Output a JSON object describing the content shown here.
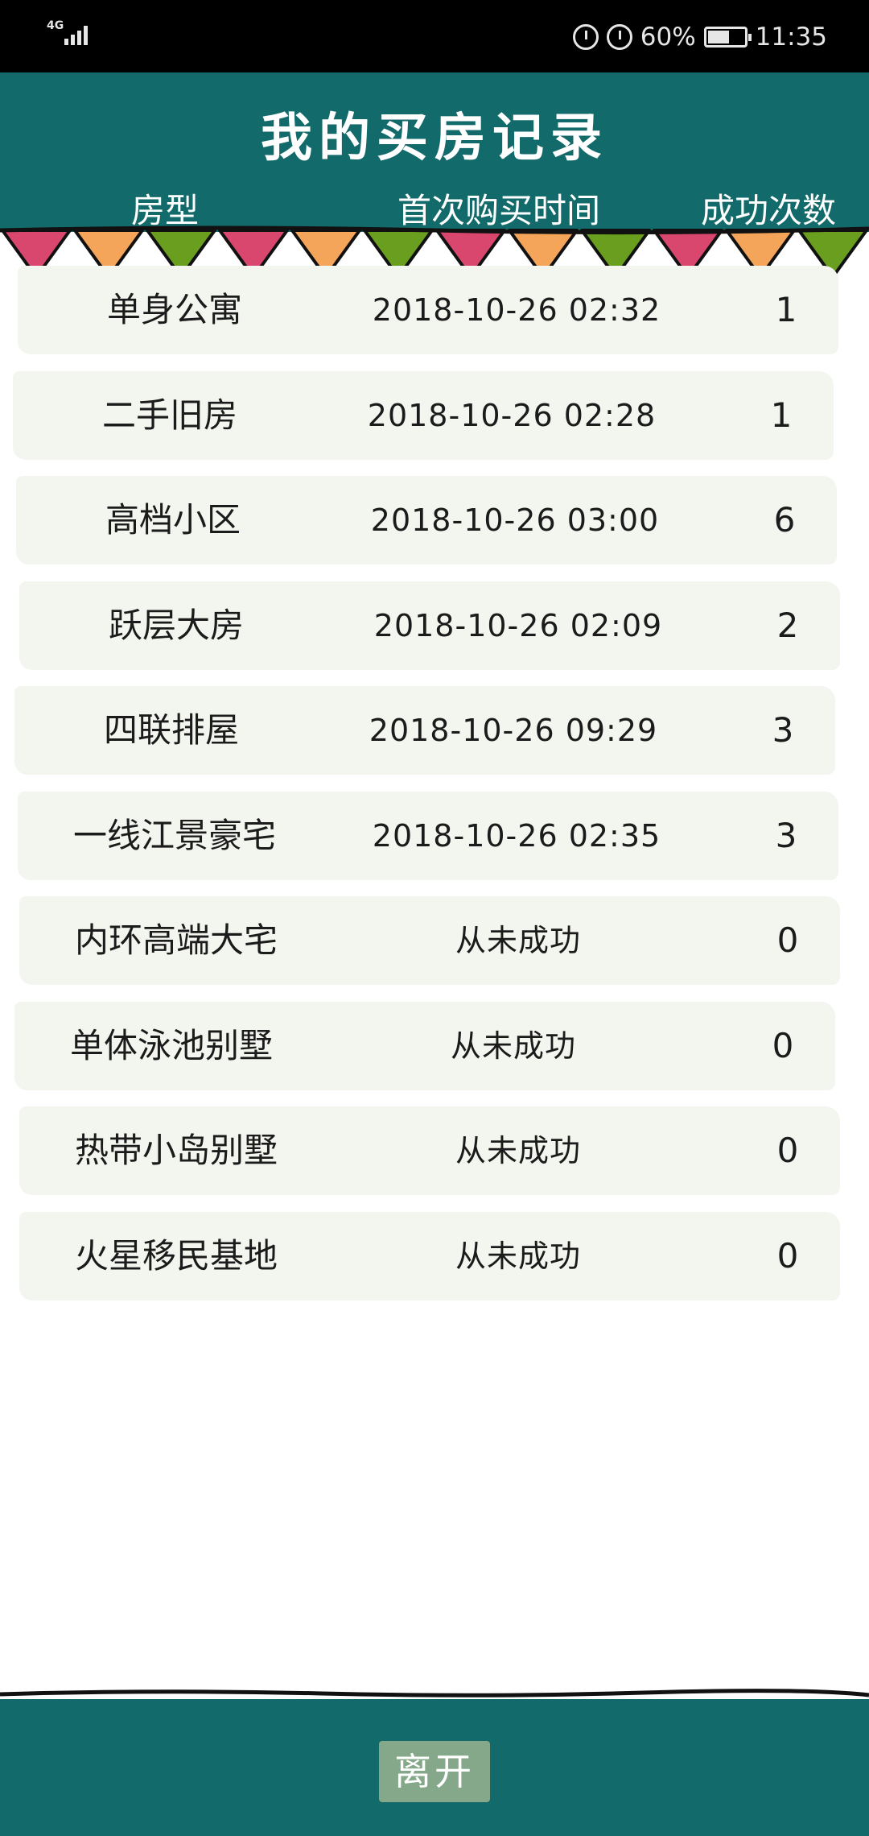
{
  "status_bar": {
    "network": "4G",
    "battery_percent_text": "60%",
    "battery_level": 0.6,
    "time": "11:35"
  },
  "page": {
    "title": "我的买房记录",
    "columns": {
      "type": "房型",
      "first_purchase_time": "首次购买时间",
      "success_count": "成功次数"
    }
  },
  "records": [
    {
      "type": "单身公寓",
      "first_purchase_time": "2018-10-26 02:32",
      "success_count": "1"
    },
    {
      "type": "二手旧房",
      "first_purchase_time": "2018-10-26 02:28",
      "success_count": "1"
    },
    {
      "type": "高档小区",
      "first_purchase_time": "2018-10-26 03:00",
      "success_count": "6"
    },
    {
      "type": "跃层大房",
      "first_purchase_time": "2018-10-26 02:09",
      "success_count": "2"
    },
    {
      "type": "四联排屋",
      "first_purchase_time": "2018-10-26 09:29",
      "success_count": "3"
    },
    {
      "type": "一线江景豪宅",
      "first_purchase_time": "2018-10-26 02:35",
      "success_count": "3"
    },
    {
      "type": "内环高端大宅",
      "first_purchase_time": "从未成功",
      "success_count": "0"
    },
    {
      "type": "单体泳池别墅",
      "first_purchase_time": "从未成功",
      "success_count": "0"
    },
    {
      "type": "热带小岛别墅",
      "first_purchase_time": "从未成功",
      "success_count": "0"
    },
    {
      "type": "火星移民基地",
      "first_purchase_time": "从未成功",
      "success_count": "0"
    }
  ],
  "footer": {
    "leave_label": "离开"
  },
  "colors": {
    "header_bg": "#136a6b",
    "row_bg": "#f3f5ef",
    "button_bg": "#84a889",
    "bunting": [
      "#d9476e",
      "#f5a55a",
      "#6a9e1e"
    ]
  }
}
